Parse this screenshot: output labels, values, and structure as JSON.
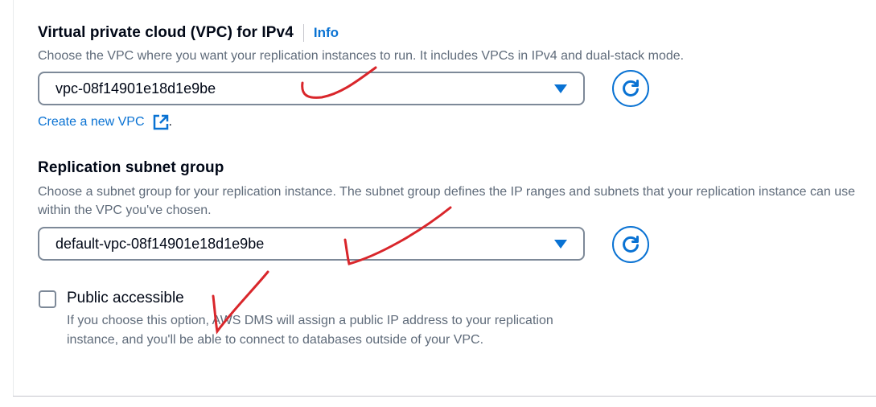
{
  "vpc": {
    "label": "Virtual private cloud (VPC) for IPv4",
    "info_label": "Info",
    "description": "Choose the VPC where you want your replication instances to run. It includes VPCs in IPv4 and dual-stack mode.",
    "selected_value": "vpc-08f14901e18d1e9be",
    "create_link": "Create a new VPC",
    "create_link_trailing": "."
  },
  "subnet": {
    "label": "Replication subnet group",
    "description": "Choose a subnet group for your replication instance. The subnet group defines the IP ranges and subnets that your replication instance can use within the VPC you've chosen.",
    "selected_value": "default-vpc-08f14901e18d1e9be"
  },
  "public_access": {
    "label": "Public accessible",
    "checked": false,
    "description": "If you choose this option, AWS DMS will assign a public IP address to your replication instance, and you'll be able to connect to databases outside of your VPC."
  },
  "colors": {
    "link": "#0972d3",
    "annotation": "#d9262b",
    "border": "#7d8998"
  },
  "icons": {
    "dropdown": "caret-down-icon",
    "refresh": "refresh-icon",
    "external": "external-link-icon"
  }
}
